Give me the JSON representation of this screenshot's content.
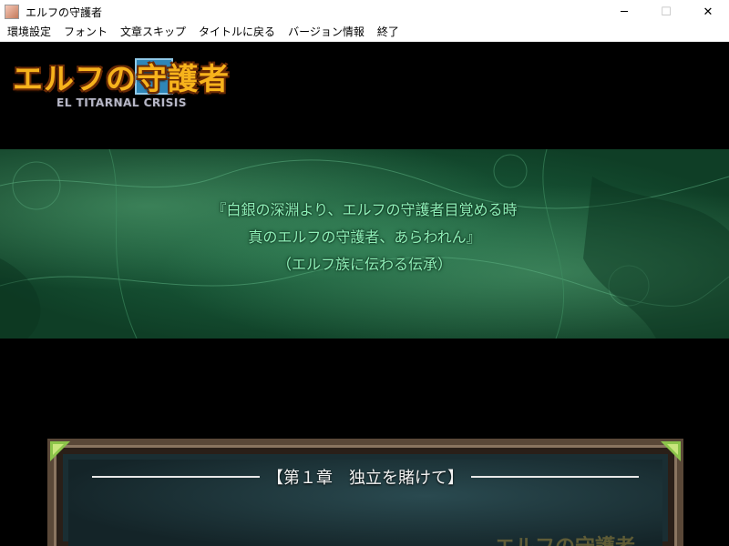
{
  "window": {
    "title": "エルフの守護者",
    "controls": {
      "minimize": "─",
      "maximize": "☐",
      "close": "✕"
    }
  },
  "menu": {
    "items": [
      "環境設定",
      "フォント",
      "文章スキップ",
      "タイトルに戻る",
      "バージョン情報",
      "終了"
    ]
  },
  "logo": {
    "title": "エルフの守護者",
    "subtitle": "EL TITARNAL CRISIS"
  },
  "prophecy": {
    "lines": [
      "『白銀の深淵より、エルフの守護者目覚める時",
      "真のエルフの守護者、あらわれん』",
      "（エルフ族に伝わる伝承）"
    ]
  },
  "chapter": {
    "title": "【第１章　独立を賭けて】",
    "watermark": "エルフの守護者"
  },
  "colors": {
    "text_green": "#8ff0b8",
    "logo_gold": "#f7b31c",
    "frame_brown": "#5a4838"
  }
}
